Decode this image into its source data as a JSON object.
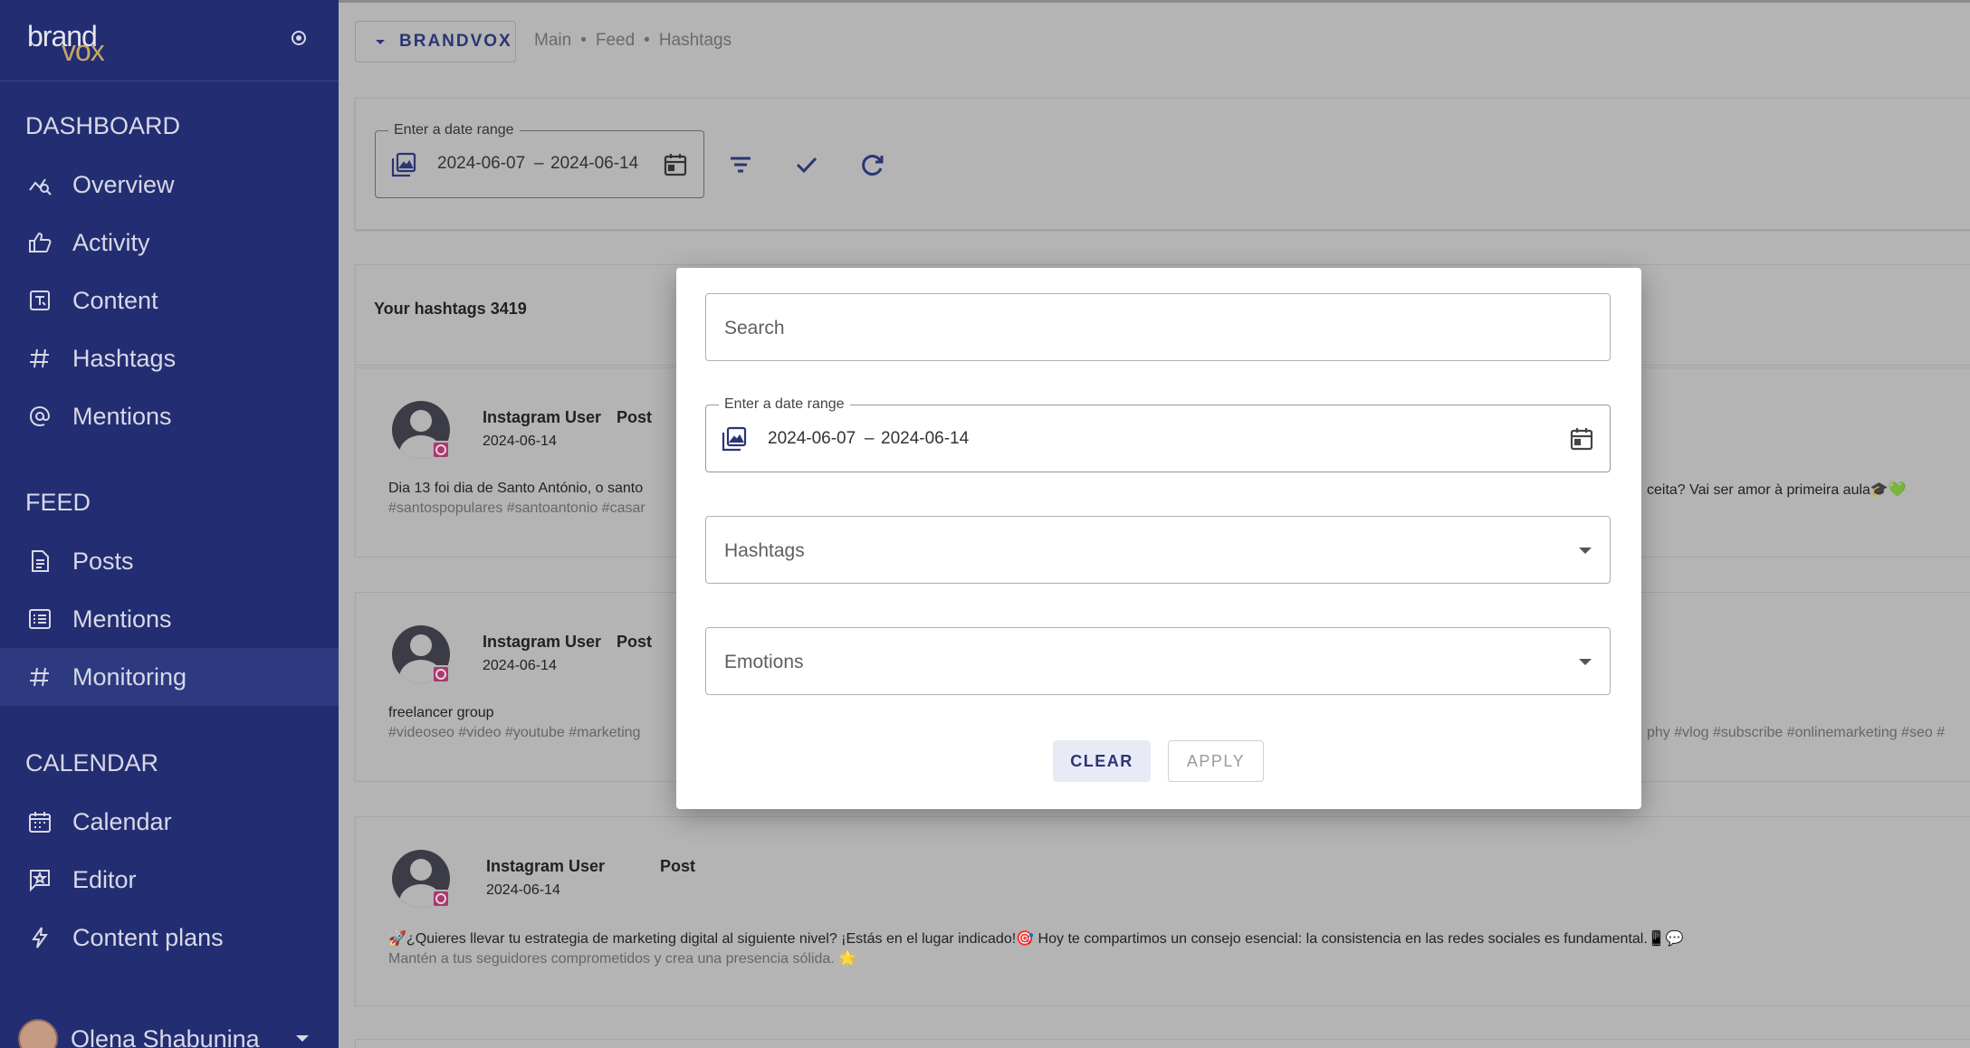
{
  "brand": {
    "part1": "brand",
    "part2": "vox"
  },
  "sidebar": {
    "sections": [
      {
        "title": "DASHBOARD",
        "items": [
          {
            "label": "Overview",
            "icon": "analytics-icon"
          },
          {
            "label": "Activity",
            "icon": "thumb-up-icon"
          },
          {
            "label": "Content",
            "icon": "content-icon"
          },
          {
            "label": "Hashtags",
            "icon": "hashtag-icon"
          },
          {
            "label": "Mentions",
            "icon": "at-sign-icon"
          }
        ]
      },
      {
        "title": "FEED",
        "items": [
          {
            "label": "Posts",
            "icon": "document-icon"
          },
          {
            "label": "Mentions",
            "icon": "list-icon"
          },
          {
            "label": "Monitoring",
            "icon": "hashtag-icon",
            "active": true
          }
        ]
      },
      {
        "title": "CALENDAR",
        "items": [
          {
            "label": "Calendar",
            "icon": "calendar-icon"
          },
          {
            "label": "Editor",
            "icon": "star-comment-icon"
          },
          {
            "label": "Content plans",
            "icon": "lightning-icon"
          }
        ]
      }
    ],
    "user": {
      "name": "Olena Shabunina"
    }
  },
  "topbar": {
    "brand_button": "BRANDVOX",
    "breadcrumb": [
      "Main",
      "Feed",
      "Hashtags"
    ]
  },
  "filter": {
    "date_label": "Enter a date range",
    "date_start": "2024-06-07",
    "date_separator": "–",
    "date_end": "2024-06-14"
  },
  "list": {
    "header": "Your hashtags 3419"
  },
  "posts": [
    {
      "user": "Instagram User",
      "type": "Post",
      "date": "2024-06-14",
      "text": "Dia 13 foi dia de Santo António, o santo",
      "text_tail": "ceita? Vai ser amor à primeira aula🎓💚",
      "tags": "#santospopulares #santoantonio #casar",
      "tags_tail": ""
    },
    {
      "user": "Instagram User",
      "type": "Post",
      "date": "2024-06-14",
      "text": "freelancer group",
      "text_tail": "",
      "tags": "#videoseo #video #youtube #marketing",
      "tags_tail": "phy #vlog #subscribe #onlinemarketing #seo #"
    },
    {
      "user": "Instagram User",
      "type": "Post",
      "date": "2024-06-14",
      "text": "🚀¿Quieres llevar tu estrategia de marketing digital al siguiente nivel? ¡Estás en el lugar indicado!🎯 Hoy te compartimos un consejo esencial: la consistencia en las redes sociales es fundamental.📱💬",
      "text_tail": "",
      "tags": "Mantén a tus seguidores comprometidos y crea una presencia sólida. 🌟",
      "tags_tail": ""
    }
  ],
  "modal": {
    "search_placeholder": "Search",
    "date_label": "Enter a date range",
    "date_start": "2024-06-07",
    "date_separator": "–",
    "date_end": "2024-06-14",
    "hashtags_placeholder": "Hashtags",
    "emotions_placeholder": "Emotions",
    "clear_label": "CLEAR",
    "apply_label": "APPLY"
  },
  "colors": {
    "sidebar_bg": "#232d72",
    "accent": "#2b3574",
    "overlay": "#b4b4b4"
  }
}
